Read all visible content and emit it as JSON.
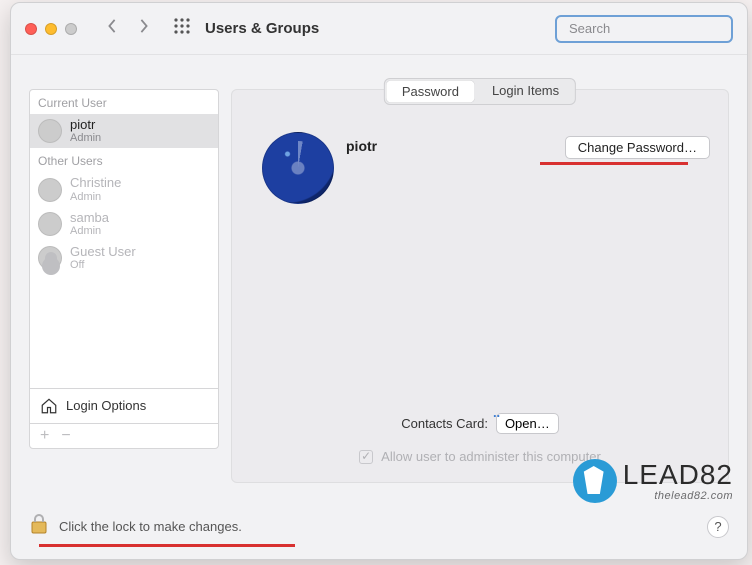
{
  "window": {
    "title": "Users & Groups"
  },
  "search": {
    "placeholder": "Search"
  },
  "sidebar": {
    "current_label": "Current User",
    "other_label": "Other Users",
    "login_options_label": "Login Options",
    "current_user": {
      "name": "piotr",
      "role": "Admin"
    },
    "others": [
      {
        "name": "Christine",
        "role": "Admin"
      },
      {
        "name": "samba",
        "role": "Admin"
      },
      {
        "name": "Guest User",
        "role": "Off"
      }
    ]
  },
  "tabs": {
    "password": "Password",
    "login_items": "Login Items"
  },
  "main": {
    "user_name": "piotr",
    "change_password_label": "Change Password…",
    "contacts_label": "Contacts Card:",
    "open_label": "Open…",
    "admin_checkbox_label": "Allow user to administer this computer"
  },
  "footer": {
    "lock_text": "Click the lock to make changes.",
    "help": "?"
  },
  "watermark": {
    "brand": "LEAD82",
    "site": "thelead82.com"
  }
}
